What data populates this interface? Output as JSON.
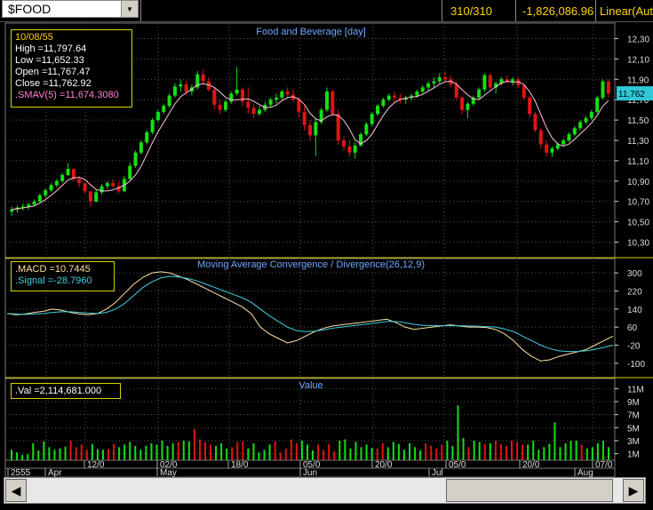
{
  "toolbar": {
    "symbol": "$FOOD",
    "count": "310/310",
    "change": "-1,826,086.96",
    "scale_mode": "Linear(Aut"
  },
  "colors": {
    "up": "#14e014",
    "down": "#e01414",
    "sma": "#ffc0e0",
    "macd": "#ffe0a0",
    "signal": "#40d0e0",
    "value_up": "#14e014",
    "value_down": "#e01414",
    "panel_border": "#d8d200",
    "grid": "#555555"
  },
  "price_panel": {
    "title": "Food and Beverage [day]",
    "info": {
      "date": "10/08/55",
      "high": "High  =11,797.64",
      "low": "Low   =11,652.33",
      "open": "Open  =11,767.47",
      "close": "Close =11,762.92",
      "sma": ".SMAV(5)   =11,674.3080"
    },
    "last_price": "11,762",
    "y_ticks": [
      "12,30",
      "12,10",
      "11,90",
      "11,70",
      "11,50",
      "11,30",
      "11,10",
      "10,90",
      "10,70",
      "10,50",
      "10,30"
    ]
  },
  "macd_panel": {
    "title": "Moving Average Convergence / Divergence(26,12,9)",
    "info": {
      "macd": ".MACD   =10.7445",
      "signal": ".Signal  =-28.7960"
    },
    "y_ticks": [
      "300",
      "220",
      "140",
      "60",
      "-20",
      "-100"
    ]
  },
  "value_panel": {
    "title": "Value",
    "info": {
      "val": ".Val   =2,114,681.000"
    },
    "y_ticks": [
      "11M",
      "9M",
      "7M",
      "5M",
      "3M",
      "1M"
    ]
  },
  "x_axis": {
    "labels": [
      "2555",
      "Apr",
      "12/0",
      "02/0",
      "May",
      "18/0",
      "05/0",
      "Jun",
      "20/0",
      "Jul",
      "05/0",
      "20/0",
      "07/0",
      "Aug"
    ]
  },
  "chart_data": [
    {
      "type": "candlestick",
      "title": "Food and Beverage [day]",
      "ylim": [
        10200,
        12400
      ],
      "series": [
        {
          "name": ".SMAV(5)",
          "values": []
        }
      ],
      "candles": [
        [
          10600,
          10650,
          10560,
          10620
        ],
        [
          10620,
          10660,
          10590,
          10640
        ],
        [
          10640,
          10680,
          10610,
          10650
        ],
        [
          10650,
          10690,
          10620,
          10670
        ],
        [
          10670,
          10720,
          10650,
          10700
        ],
        [
          10700,
          10780,
          10690,
          10760
        ],
        [
          10760,
          10830,
          10740,
          10810
        ],
        [
          10810,
          10880,
          10790,
          10860
        ],
        [
          10860,
          10920,
          10840,
          10900
        ],
        [
          10900,
          10980,
          10880,
          10960
        ],
        [
          10960,
          11080,
          10950,
          11020
        ],
        [
          11020,
          11000,
          10900,
          10920
        ],
        [
          10920,
          10950,
          10840,
          10880
        ],
        [
          10880,
          10860,
          10780,
          10800
        ],
        [
          10800,
          10780,
          10650,
          10700
        ],
        [
          10700,
          10820,
          10690,
          10790
        ],
        [
          10790,
          10870,
          10770,
          10850
        ],
        [
          10850,
          10900,
          10820,
          10880
        ],
        [
          10880,
          10920,
          10830,
          10850
        ],
        [
          10850,
          10890,
          10780,
          10800
        ],
        [
          10800,
          10950,
          10790,
          10920
        ],
        [
          10920,
          11080,
          10910,
          11050
        ],
        [
          11050,
          11200,
          11030,
          11180
        ],
        [
          11180,
          11300,
          11160,
          11280
        ],
        [
          11280,
          11400,
          11260,
          11380
        ],
        [
          11380,
          11520,
          11360,
          11500
        ],
        [
          11500,
          11600,
          11480,
          11580
        ],
        [
          11580,
          11660,
          11560,
          11640
        ],
        [
          11640,
          11760,
          11620,
          11740
        ],
        [
          11740,
          11860,
          11720,
          11830
        ],
        [
          11830,
          11900,
          11780,
          11850
        ],
        [
          11850,
          11880,
          11750,
          11780
        ],
        [
          11780,
          11850,
          11740,
          11820
        ],
        [
          11820,
          11980,
          11800,
          11950
        ],
        [
          11950,
          12000,
          11860,
          11880
        ],
        [
          11880,
          11920,
          11780,
          11800
        ],
        [
          11800,
          11820,
          11600,
          11650
        ],
        [
          11650,
          11700,
          11560,
          11600
        ],
        [
          11600,
          11700,
          11580,
          11680
        ],
        [
          11680,
          11780,
          11660,
          11760
        ],
        [
          11760,
          12020,
          11740,
          11800
        ],
        [
          11800,
          11820,
          11640,
          11680
        ],
        [
          11680,
          11820,
          11560,
          11620
        ],
        [
          11620,
          11660,
          11520,
          11560
        ],
        [
          11560,
          11640,
          11540,
          11600
        ],
        [
          11600,
          11680,
          11580,
          11650
        ],
        [
          11650,
          11720,
          11620,
          11700
        ],
        [
          11700,
          11760,
          11660,
          11720
        ],
        [
          11720,
          11800,
          11700,
          11780
        ],
        [
          11780,
          11820,
          11720,
          11750
        ],
        [
          11750,
          11800,
          11680,
          11700
        ],
        [
          11700,
          11720,
          11520,
          11580
        ],
        [
          11580,
          11640,
          11400,
          11450
        ],
        [
          11450,
          11500,
          11300,
          11350
        ],
        [
          11350,
          11520,
          11150,
          11480
        ],
        [
          11480,
          11620,
          11460,
          11600
        ],
        [
          11600,
          11820,
          11580,
          11780
        ],
        [
          11780,
          11800,
          11540,
          11560
        ],
        [
          11560,
          11600,
          11260,
          11300
        ],
        [
          11300,
          11340,
          11200,
          11240
        ],
        [
          11240,
          11300,
          11140,
          11180
        ],
        [
          11180,
          11280,
          11120,
          11250
        ],
        [
          11250,
          11380,
          11240,
          11360
        ],
        [
          11360,
          11480,
          11340,
          11460
        ],
        [
          11460,
          11580,
          11440,
          11560
        ],
        [
          11560,
          11660,
          11540,
          11640
        ],
        [
          11640,
          11720,
          11620,
          11700
        ],
        [
          11700,
          11760,
          11680,
          11740
        ],
        [
          11740,
          11780,
          11680,
          11720
        ],
        [
          11720,
          11760,
          11660,
          11700
        ],
        [
          11700,
          11740,
          11660,
          11720
        ],
        [
          11720,
          11760,
          11690,
          11740
        ],
        [
          11740,
          11800,
          11720,
          11780
        ],
        [
          11780,
          11840,
          11760,
          11820
        ],
        [
          11820,
          11880,
          11780,
          11860
        ],
        [
          11860,
          11920,
          11820,
          11880
        ],
        [
          11880,
          11960,
          11860,
          11920
        ],
        [
          11920,
          11980,
          11880,
          11900
        ],
        [
          11900,
          11940,
          11820,
          11850
        ],
        [
          11850,
          11880,
          11700,
          11720
        ],
        [
          11720,
          11740,
          11560,
          11600
        ],
        [
          11600,
          11680,
          11520,
          11660
        ],
        [
          11660,
          11740,
          11640,
          11720
        ],
        [
          11720,
          11820,
          11700,
          11800
        ],
        [
          11800,
          11960,
          11780,
          11940
        ],
        [
          11940,
          11960,
          11800,
          11820
        ],
        [
          11820,
          11880,
          11760,
          11860
        ],
        [
          11860,
          11920,
          11840,
          11900
        ],
        [
          11900,
          11940,
          11860,
          11880
        ],
        [
          11880,
          11920,
          11840,
          11900
        ],
        [
          11900,
          11920,
          11820,
          11840
        ],
        [
          11840,
          11860,
          11700,
          11720
        ],
        [
          11720,
          11740,
          11520,
          11560
        ],
        [
          11560,
          11580,
          11380,
          11400
        ],
        [
          11400,
          11420,
          11220,
          11260
        ],
        [
          11260,
          11300,
          11140,
          11180
        ],
        [
          11180,
          11240,
          11140,
          11220
        ],
        [
          11220,
          11280,
          11200,
          11260
        ],
        [
          11260,
          11320,
          11240,
          11300
        ],
        [
          11300,
          11380,
          11280,
          11360
        ],
        [
          11360,
          11440,
          11340,
          11420
        ],
        [
          11420,
          11500,
          11400,
          11480
        ],
        [
          11480,
          11540,
          11460,
          11520
        ],
        [
          11520,
          11600,
          11500,
          11580
        ],
        [
          11580,
          11740,
          11560,
          11720
        ],
        [
          11720,
          11900,
          11700,
          11880
        ],
        [
          11880,
          11900,
          11720,
          11760
        ]
      ]
    },
    {
      "type": "line",
      "title": "Moving Average Convergence / Divergence(26,12,9)",
      "ylim": [
        -140,
        340
      ],
      "series": [
        {
          "name": ".MACD",
          "values": [
            120,
            115,
            118,
            125,
            130,
            140,
            135,
            125,
            118,
            115,
            120,
            140,
            170,
            210,
            250,
            280,
            300,
            305,
            300,
            285,
            270,
            250,
            230,
            210,
            190,
            170,
            150,
            120,
            60,
            30,
            10,
            -10,
            0,
            20,
            40,
            55,
            65,
            70,
            75,
            80,
            85,
            90,
            95,
            80,
            60,
            50,
            55,
            60,
            65,
            70,
            65,
            60,
            60,
            58,
            50,
            30,
            0,
            -40,
            -70,
            -90,
            -85,
            -70,
            -60,
            -50,
            -40,
            -20,
            0,
            20
          ]
        },
        {
          "name": ".Signal",
          "values": [
            120,
            118,
            116,
            118,
            120,
            125,
            128,
            128,
            125,
            122,
            120,
            125,
            140,
            165,
            200,
            235,
            260,
            278,
            285,
            282,
            275,
            265,
            250,
            235,
            220,
            205,
            190,
            170,
            140,
            110,
            85,
            60,
            45,
            40,
            42,
            48,
            55,
            60,
            65,
            70,
            75,
            80,
            85,
            85,
            80,
            72,
            68,
            66,
            66,
            66,
            66,
            65,
            64,
            62,
            60,
            52,
            40,
            20,
            0,
            -20,
            -35,
            -45,
            -48,
            -48,
            -45,
            -38,
            -30,
            -20
          ]
        }
      ]
    },
    {
      "type": "bar",
      "title": "Value",
      "ylim": [
        0,
        12
      ],
      "values": [
        1.6,
        1.2,
        0.8,
        0.9,
        2.6,
        1.5,
        2.9,
        2.0,
        1.6,
        1.8,
        2.1,
        3.0,
        2.0,
        2.4,
        1.6,
        2.5,
        1.7,
        1.6,
        1.7,
        2.5,
        2.0,
        2.4,
        2.8,
        2.2,
        1.6,
        2.2,
        2.6,
        2.4,
        3.0,
        2.2,
        2.6,
        2.8,
        3.0,
        2.9,
        4.8,
        3.2,
        2.8,
        2.4,
        2.2,
        2.6,
        1.8,
        2.0,
        2.8,
        2.9,
        1.8,
        2.6,
        1.2,
        1.6,
        2.4,
        2.9,
        1.2,
        1.8,
        3.2,
        2.6,
        3.0,
        2.4,
        1.5,
        2.4,
        1.6,
        2.5,
        1.4,
        3.0,
        3.2,
        1.8,
        2.8,
        2.0,
        2.4,
        1.9,
        1.8,
        2.6,
        2.0,
        2.8,
        2.5,
        1.6,
        2.6,
        2.0,
        1.5,
        2.6,
        2.2,
        1.8,
        2.4,
        3.0,
        2.2,
        8.4,
        3.4,
        2.0,
        3.0,
        2.8,
        2.5,
        2.6,
        3.0,
        2.5,
        2.2,
        3.0,
        2.8,
        2.4,
        2.4,
        3.0,
        1.6,
        2.0,
        2.5,
        5.8,
        2.0,
        2.6,
        3.0,
        3.0,
        2.4,
        1.8,
        2.0,
        2.6,
        3.0,
        2.0
      ]
    }
  ]
}
